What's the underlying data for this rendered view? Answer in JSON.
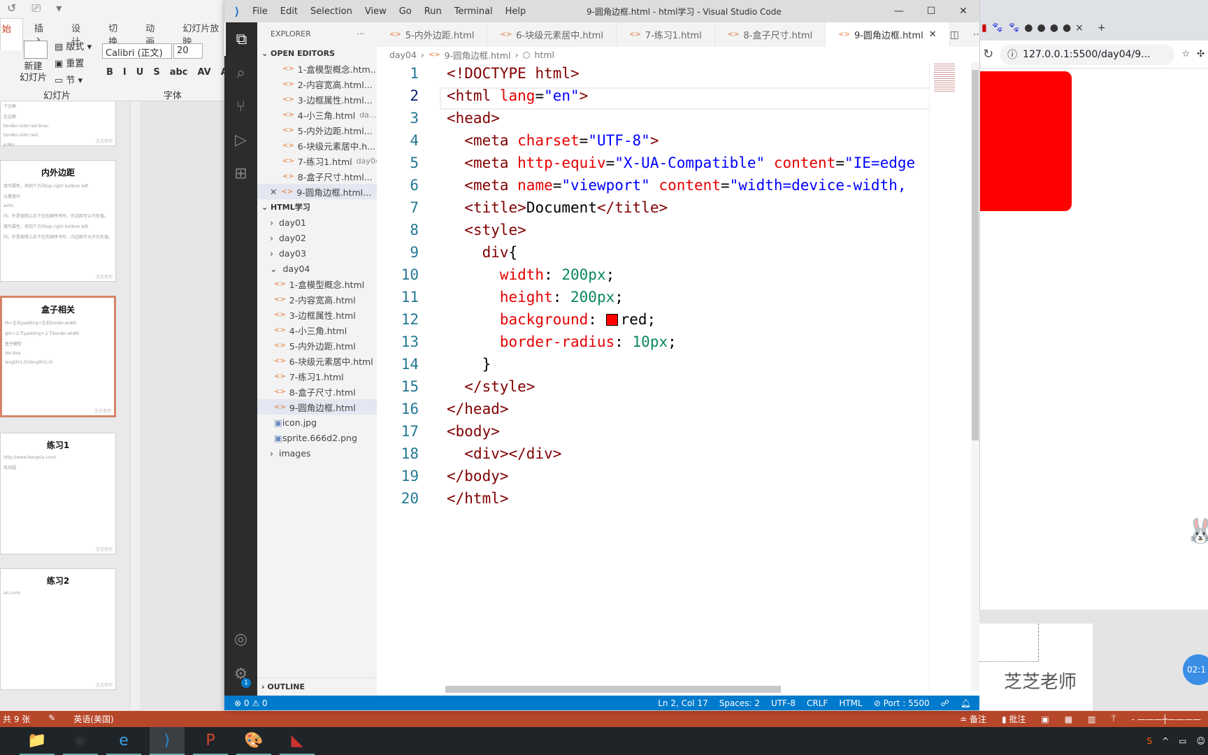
{
  "ppt": {
    "tabs": [
      "始",
      "插入",
      "设计",
      "切换",
      "动画",
      "幻灯片放映"
    ],
    "new_slide": "新建\n幻灯片",
    "layout": "版式",
    "reset": "重置",
    "section": "节",
    "group_slides": "幻灯片",
    "group_font": "字体",
    "font_name": "Calibri (正文)",
    "font_size": "20",
    "format_buttons": [
      "B",
      "I",
      "U",
      "S",
      "abc",
      "AV",
      "Aa"
    ],
    "slides": [
      {
        "title": "",
        "lines": [
          "右边框",
          "下边框",
          "左边框",
          "border-color:red blue;",
          "border-color:red;",
          "标题3",
          "标题4"
        ]
      },
      {
        "title": "内外边距",
        "lines": [
          "填写属性，有四个方向top right bottom left",
          "元素居中",
          "auto;",
          "内，外是按照上右下左的顺序书写，外边距可以为负值。",
          "填写属性，有四个方向top right bottom left",
          "内，外是按照上右下左的顺序书写，内边距不允许为负值。"
        ]
      },
      {
        "title": "盒子相关",
        "lines": [
          "th+左右padding+左右border-width",
          "ght+上下padding+上下border-width",
          "盒子模型",
          "der-box",
          "length(1,0)/length(1,0)"
        ]
      },
      {
        "title": "练习1",
        "lines": [
          "http://www.hongxiu.com/",
          "风尚圈"
        ]
      },
      {
        "title": "练习2",
        "lines": [
          "an.com/"
        ]
      }
    ],
    "slide_footer": "芝芝老师",
    "status": {
      "slide_count": "共 9 张",
      "language": "英语(美国)",
      "notes": "备注",
      "comments": "批注"
    }
  },
  "vscode": {
    "menu": [
      "File",
      "Edit",
      "Selection",
      "View",
      "Go",
      "Run",
      "Terminal",
      "Help"
    ],
    "window_title": "9-圆角边框.html - html学习 - Visual Studio Code",
    "explorer_title": "EXPLORER",
    "open_editors_label": "OPEN EDITORS",
    "open_editors": [
      {
        "name": "1-盒模型概念.htm...",
        "desc": ""
      },
      {
        "name": "2-内容宽高.html...",
        "desc": ""
      },
      {
        "name": "3-边框属性.html...",
        "desc": ""
      },
      {
        "name": "4-小三角.html",
        "desc": "da..."
      },
      {
        "name": "5-内外边距.html...",
        "desc": ""
      },
      {
        "name": "6-块级元素居中.h...",
        "desc": ""
      },
      {
        "name": "7-练习1.html",
        "desc": "day04"
      },
      {
        "name": "8-盒子尺寸.html...",
        "desc": ""
      },
      {
        "name": "9-圆角边框.html...",
        "desc": "",
        "active": true
      }
    ],
    "workspace_label": "HTML学习",
    "folders": [
      "day01",
      "day02",
      "day03"
    ],
    "open_folder": "day04",
    "day04_files": [
      "1-盒模型概念.html",
      "2-内容宽高.html",
      "3-边框属性.html",
      "4-小三角.html",
      "5-内外边距.html",
      "6-块级元素居中.html",
      "7-练习1.html",
      "8-盒子尺寸.html",
      "9-圆角边框.html"
    ],
    "images_files": [
      "icon.jpg",
      "sprite.666d2.png"
    ],
    "images_folder": "images",
    "outline_label": "OUTLINE",
    "tabs": [
      "5-内外边距.html",
      "6-块级元素居中.html",
      "7-练习1.html",
      "8-盒子尺寸.html",
      "9-圆角边框.html"
    ],
    "active_tab": 4,
    "breadcrumb": [
      "day04",
      "9-圆角边框.html",
      "html"
    ],
    "code": [
      [
        [
          "tag",
          "<!DOCTYPE "
        ],
        [
          "sel",
          "html"
        ],
        [
          "tag",
          ">"
        ]
      ],
      [
        [
          "tag",
          "<html "
        ],
        [
          "attr",
          "lang"
        ],
        [
          "plain",
          "="
        ],
        [
          "str",
          "\"en\""
        ],
        [
          "tag",
          ">"
        ]
      ],
      [
        [
          "tag",
          "<head>"
        ]
      ],
      [
        [
          "plain",
          "  "
        ],
        [
          "tag",
          "<meta "
        ],
        [
          "attr",
          "charset"
        ],
        [
          "plain",
          "="
        ],
        [
          "str",
          "\"UTF-8\""
        ],
        [
          "tag",
          ">"
        ]
      ],
      [
        [
          "plain",
          "  "
        ],
        [
          "tag",
          "<meta "
        ],
        [
          "attr",
          "http-equiv"
        ],
        [
          "plain",
          "="
        ],
        [
          "str",
          "\"X-UA-Compatible\" "
        ],
        [
          "attr",
          "content"
        ],
        [
          "plain",
          "="
        ],
        [
          "str",
          "\"IE=edge"
        ]
      ],
      [
        [
          "plain",
          "  "
        ],
        [
          "tag",
          "<meta "
        ],
        [
          "attr",
          "name"
        ],
        [
          "plain",
          "="
        ],
        [
          "str",
          "\"viewport\" "
        ],
        [
          "attr",
          "content"
        ],
        [
          "plain",
          "="
        ],
        [
          "str",
          "\"width=device-width,"
        ]
      ],
      [
        [
          "plain",
          "  "
        ],
        [
          "tag",
          "<title>"
        ],
        [
          "plain",
          "Document"
        ],
        [
          "tag",
          "</title>"
        ]
      ],
      [
        [
          "plain",
          "  "
        ],
        [
          "tag",
          "<style>"
        ]
      ],
      [
        [
          "plain",
          "    "
        ],
        [
          "sel",
          "div"
        ],
        [
          "plain",
          "{"
        ]
      ],
      [
        [
          "plain",
          "      "
        ],
        [
          "prop",
          "width"
        ],
        [
          "plain",
          ": "
        ],
        [
          "num",
          "200px"
        ],
        [
          "plain",
          ";"
        ]
      ],
      [
        [
          "plain",
          "      "
        ],
        [
          "prop",
          "height"
        ],
        [
          "plain",
          ": "
        ],
        [
          "num",
          "200px"
        ],
        [
          "plain",
          ";"
        ]
      ],
      [
        [
          "plain",
          "      "
        ],
        [
          "prop",
          "background"
        ],
        [
          "plain",
          ": "
        ],
        [
          "swatch",
          ""
        ],
        [
          "plain",
          "red;"
        ]
      ],
      [
        [
          "plain",
          "      "
        ],
        [
          "prop",
          "border-radius"
        ],
        [
          "plain",
          ": "
        ],
        [
          "num",
          "10px"
        ],
        [
          "plain",
          ";"
        ]
      ],
      [
        [
          "plain",
          "    }"
        ]
      ],
      [
        [
          "plain",
          "  "
        ],
        [
          "tag",
          "</style>"
        ]
      ],
      [
        [
          "tag",
          "</head>"
        ]
      ],
      [
        [
          "tag",
          "<body>"
        ]
      ],
      [
        [
          "plain",
          "  "
        ],
        [
          "tag",
          "<div></div>"
        ]
      ],
      [
        [
          "tag",
          "</body>"
        ]
      ],
      [
        [
          "tag",
          "</html>"
        ]
      ]
    ],
    "current_line": 2,
    "status": {
      "problems": "⊗ 0 ⚠ 0",
      "position": "Ln 2, Col 17",
      "spaces": "Spaces: 2",
      "encoding": "UTF-8",
      "eol": "CRLF",
      "language": "HTML",
      "port": "⊘ Port : 5500"
    },
    "accounts_badge": "1"
  },
  "browser": {
    "url": "127.0.0.1:5500/day04/9...",
    "close_tab": "×",
    "new_tab": "+"
  },
  "overlay": {
    "teacher": "芝芝老师",
    "timer": "02:1"
  },
  "colors": {
    "vscode_status": "#007acc",
    "ppt_accent": "#b7472a",
    "box": "#ff0000"
  }
}
